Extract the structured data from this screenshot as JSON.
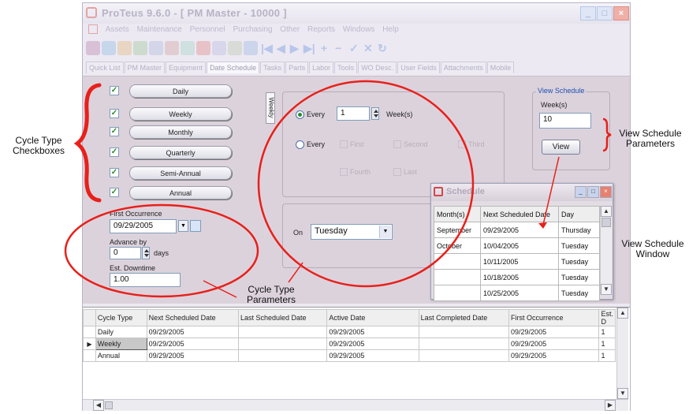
{
  "window": {
    "title": "ProTeus 9.6.0 - [ PM Master - 10000 ]",
    "menu": [
      "Assets",
      "Maintenance",
      "Personnel",
      "Purchasing",
      "Other",
      "Reports",
      "Windows",
      "Help"
    ],
    "tabs": [
      "Quick List",
      "PM Master",
      "Equipment",
      "Date Schedule",
      "Tasks",
      "Parts",
      "Labor",
      "Tools",
      "WO Desc.",
      "User Fields",
      "Attachments",
      "Mobile"
    ],
    "active_tab": "Date Schedule"
  },
  "cycle_types": [
    {
      "label": "Daily",
      "checked": true
    },
    {
      "label": "Weekly",
      "checked": true
    },
    {
      "label": "Monthly",
      "checked": true
    },
    {
      "label": "Quarterly",
      "checked": true
    },
    {
      "label": "Semi-Annual",
      "checked": true
    },
    {
      "label": "Annual",
      "checked": true
    }
  ],
  "first_occurrence": {
    "label": "First Occurrence",
    "value": "09/29/2005"
  },
  "advance_by": {
    "label": "Advance by",
    "value": "0",
    "unit": "days"
  },
  "est_downtime": {
    "label": "Est. Downtime",
    "value": "1.00"
  },
  "weekly_panel": {
    "vertical_tab": "Weekly",
    "every_label": "Every",
    "every_value": "1",
    "weeks_unit": "Week(s)",
    "every2_label": "Every",
    "options_row1": [
      "First",
      "Second",
      "Third"
    ],
    "options_row2": [
      "Fourth",
      "Last"
    ],
    "on_label": "On",
    "on_value": "Tuesday"
  },
  "view_schedule": {
    "group_label": "View Schedule",
    "weeks_label": "Week(s)",
    "weeks_value": "10",
    "button": "View"
  },
  "schedule_window": {
    "title": "Schedule",
    "headers": [
      "Month(s)",
      "Next Scheduled Date",
      "Day"
    ],
    "rows": [
      {
        "month": "September",
        "date": "09/29/2005",
        "day": "Thursday"
      },
      {
        "month": "October",
        "date": "10/04/2005",
        "day": "Tuesday"
      },
      {
        "month": "",
        "date": "10/11/2005",
        "day": "Tuesday"
      },
      {
        "month": "",
        "date": "10/18/2005",
        "day": "Tuesday"
      },
      {
        "month": "",
        "date": "10/25/2005",
        "day": "Tuesday"
      }
    ]
  },
  "grid": {
    "headers": [
      "Cycle Type",
      "Next Scheduled Date",
      "Last Scheduled Date",
      "Active Date",
      "Last Completed Date",
      "First Occurrence",
      "Est. D"
    ],
    "rows": [
      {
        "cycle": "Daily",
        "next": "09/29/2005",
        "last": "",
        "active": "09/29/2005",
        "completed": "",
        "first": "09/29/2005",
        "est": "1"
      },
      {
        "cycle": "Weekly",
        "next": "09/29/2005",
        "last": "",
        "active": "09/29/2005",
        "completed": "",
        "first": "09/29/2005",
        "est": "1"
      },
      {
        "cycle": "Annual",
        "next": "09/29/2005",
        "last": "",
        "active": "09/29/2005",
        "completed": "",
        "first": "09/29/2005",
        "est": "1"
      }
    ],
    "selected_row": "Weekly"
  },
  "annotations": {
    "cycle_type_checkboxes": [
      "Cycle Type",
      "Checkboxes"
    ],
    "cycle_type_parameters": [
      "Cycle Type",
      "Parameters"
    ],
    "view_schedule_parameters": [
      "View Schedule",
      "Parameters"
    ],
    "view_schedule_window": [
      "View Schedule",
      "Window"
    ]
  },
  "colors": {
    "annotation_red": "#e8201a",
    "check_green": "#2a8a2a",
    "tab_body": "#dcd2dc"
  }
}
